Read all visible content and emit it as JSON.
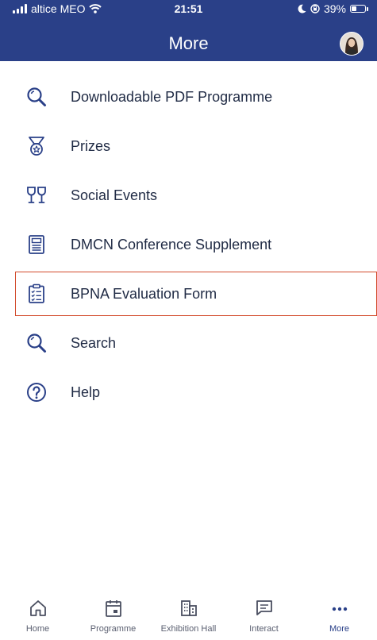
{
  "status_bar": {
    "carrier": "altice MEO",
    "time": "21:51",
    "battery": "39%"
  },
  "header": {
    "title": "More"
  },
  "menu": {
    "items": [
      {
        "label": "Downloadable PDF Programme",
        "icon": "search-icon"
      },
      {
        "label": "Prizes",
        "icon": "medal-icon"
      },
      {
        "label": "Social Events",
        "icon": "glasses-icon"
      },
      {
        "label": "DMCN Conference Supplement",
        "icon": "document-icon"
      },
      {
        "label": "BPNA Evaluation Form",
        "icon": "clipboard-checklist-icon",
        "selected": true
      },
      {
        "label": "Search",
        "icon": "search-icon"
      },
      {
        "label": "Help",
        "icon": "help-icon"
      }
    ]
  },
  "tabbar": {
    "tabs": [
      {
        "label": "Home",
        "icon": "home-icon"
      },
      {
        "label": "Programme",
        "icon": "calendar-icon"
      },
      {
        "label": "Exhibition Hall",
        "icon": "building-icon"
      },
      {
        "label": "Interact",
        "icon": "chat-icon"
      },
      {
        "label": "More",
        "icon": "more-icon",
        "active": true
      }
    ]
  },
  "colors": {
    "header_bg": "#2a4088",
    "selected_border": "#d24a2b",
    "text": "#1f2a44"
  }
}
